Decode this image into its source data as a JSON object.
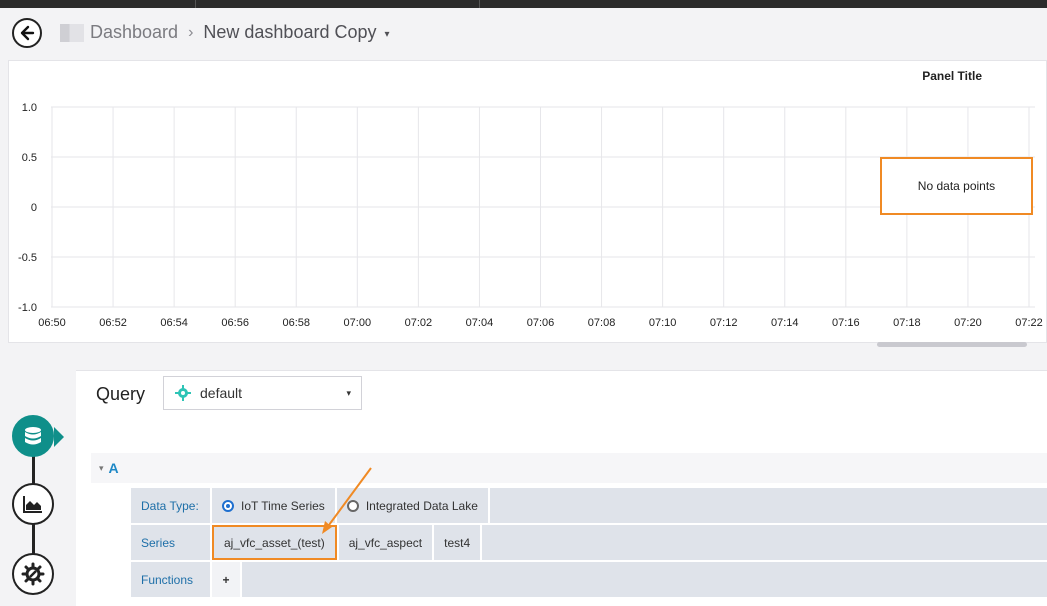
{
  "header": {
    "breadcrumb_root": "Dashboard",
    "breadcrumb_separator": "›",
    "dashboard_title": "New dashboard Copy",
    "title_caret": "▾"
  },
  "panel": {
    "title": "Panel Title",
    "no_data_text": "No data points"
  },
  "chart_data": {
    "type": "line",
    "title": "Panel Title",
    "x_ticks": [
      "06:50",
      "06:52",
      "06:54",
      "06:56",
      "06:58",
      "07:00",
      "07:02",
      "07:04",
      "07:06",
      "07:08",
      "07:10",
      "07:12",
      "07:14",
      "07:16",
      "07:18",
      "07:20",
      "07:22"
    ],
    "y_ticks": [
      "1.0",
      "0.5",
      "0",
      "-0.5",
      "-1.0"
    ],
    "ylim": [
      -1.0,
      1.0
    ],
    "grid": true,
    "series": []
  },
  "query": {
    "label": "Query",
    "datasource": "default",
    "datasource_caret": "▾",
    "section_label": "A",
    "section_caret": "▾",
    "data_type_label": "Data Type:",
    "data_type_options": [
      "IoT Time Series",
      "Integrated Data Lake"
    ],
    "selected_data_type": "IoT Time Series",
    "series_label": "Series",
    "series_values": [
      "aj_vfc_asset_(test)",
      "aj_vfc_aspect",
      "test4"
    ],
    "functions_label": "Functions",
    "add_function_symbol": "+"
  },
  "colors": {
    "accent": "#0f8f8a",
    "highlight": "#f08a24",
    "link": "#1e88c6"
  },
  "icons": {
    "back": "arrow-left-icon",
    "database": "database-icon",
    "visualization": "area-chart-icon",
    "settings": "gear-icon"
  }
}
